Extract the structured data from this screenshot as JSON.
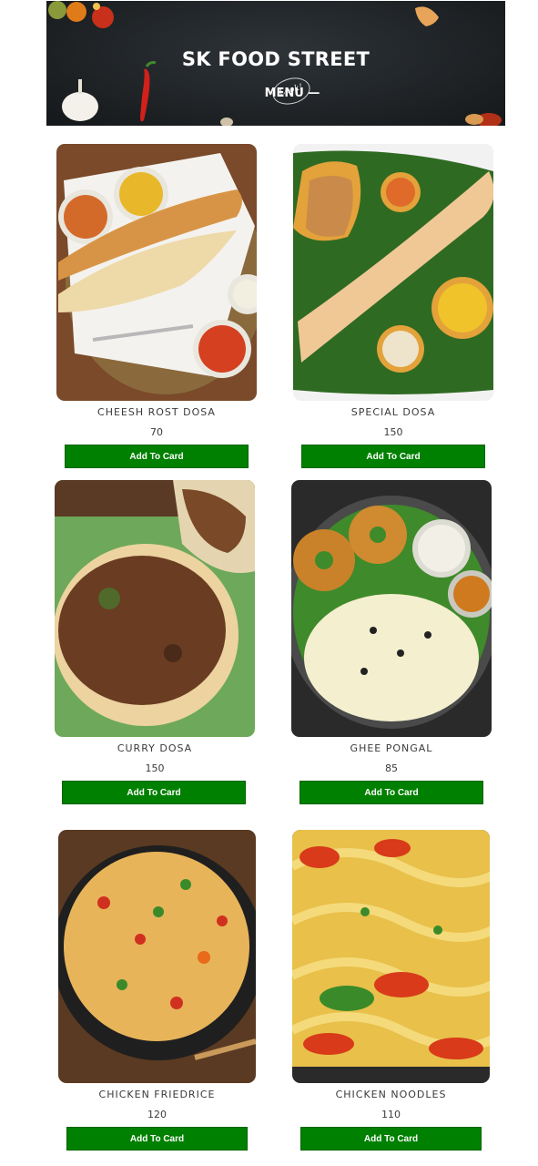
{
  "header": {
    "title": "SK FOOD STREET",
    "look_badge": "Look!",
    "subtitle": "MENU —"
  },
  "colors": {
    "button": "#008000",
    "header_bg": "#1f2326"
  },
  "items": [
    {
      "name": "CHEESH ROST DOSA",
      "price": "70",
      "button_label": "Add To Card",
      "photo": "cheese-roast-dosa-photo"
    },
    {
      "name": "SPECIAL DOSA",
      "price": "150",
      "button_label": "Add To Card",
      "photo": "special-dosa-photo"
    },
    {
      "name": "CURRY DOSA",
      "price": "150",
      "button_label": "Add To Card",
      "photo": "curry-dosa-photo"
    },
    {
      "name": "GHEE PONGAL",
      "price": "85",
      "button_label": "Add To Card",
      "photo": "ghee-pongal-photo"
    },
    {
      "name": "CHICKEN FRIEDRICE",
      "price": "120",
      "button_label": "Add To Card",
      "photo": "chicken-fried-rice-photo"
    },
    {
      "name": "CHICKEN NOODLES",
      "price": "110",
      "button_label": "Add To Card",
      "photo": "chicken-noodles-photo"
    }
  ]
}
